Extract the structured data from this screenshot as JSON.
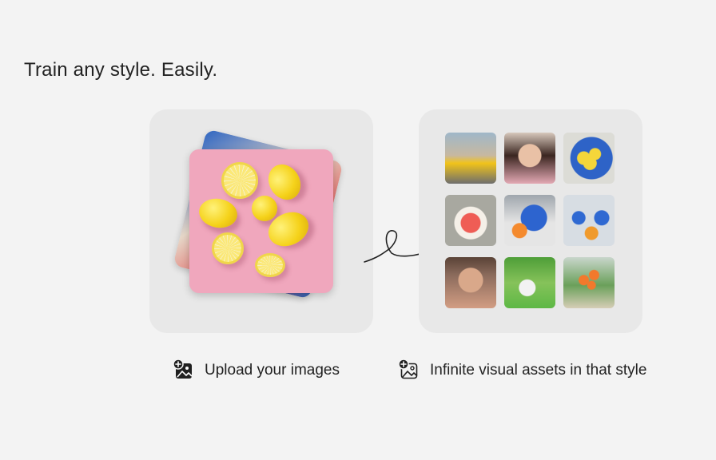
{
  "headline": "Train any style. Easily.",
  "upload": {
    "label": "Upload your images",
    "icon": "add-image-icon"
  },
  "output": {
    "label": "Infinite visual assets in that style",
    "icon": "add-image-icon"
  },
  "thumbnails": [
    "taxi-street-thumbnail",
    "woman-portrait-thumbnail",
    "lemons-plate-thumbnail",
    "watermelon-plate-thumbnail",
    "blue-bowl-oranges-thumbnail",
    "blue-glass-oranges-thumbnail",
    "man-portrait-thumbnail",
    "dog-park-thumbnail",
    "orange-tree-thumbnail"
  ]
}
